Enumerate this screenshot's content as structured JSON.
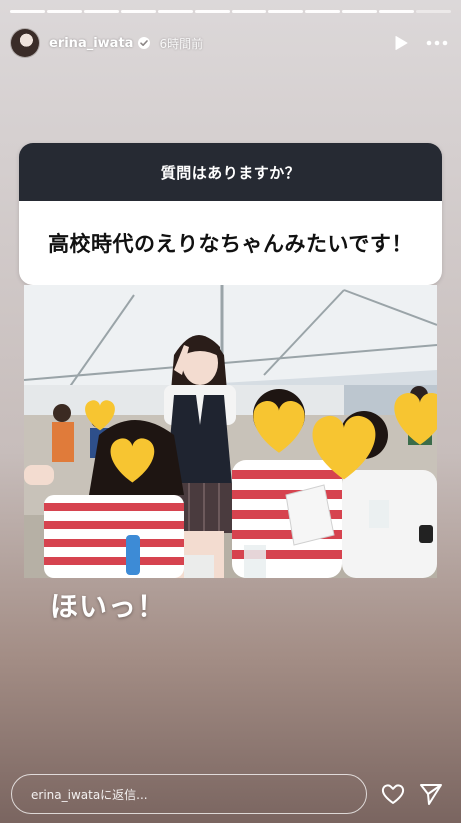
{
  "story": {
    "segments_total": 12,
    "segments_done": 11,
    "username": "erina_iwata",
    "verified_icon": "verified-badge-icon",
    "timestamp": "6時間前",
    "header_icons": [
      "play-icon",
      "more-icon"
    ]
  },
  "question_sticker": {
    "prompt": "質問はありますか？",
    "answer": "高校時代のえりなちゃんみたいです！"
  },
  "photo": {
    "description_icons": [
      "heart-emoji-icon"
    ]
  },
  "caption": "ほいっ！",
  "reply_bar": {
    "placeholder": "erina_iwataに返信...",
    "icons": [
      "heart-icon",
      "send-icon"
    ]
  },
  "colors": {
    "sticker_header": "#262a33",
    "sticker_body": "#ffffff",
    "emoji_heart": "#f7c531"
  }
}
